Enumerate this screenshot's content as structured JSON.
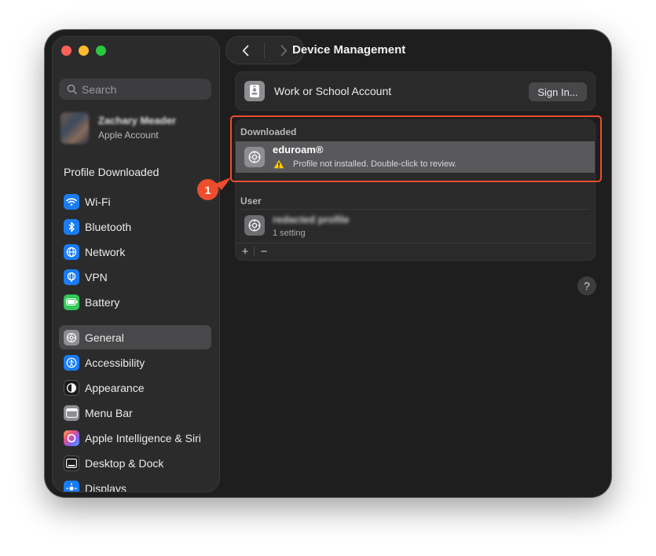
{
  "window": {
    "title": "Device Management"
  },
  "sidebar": {
    "search_placeholder": "Search",
    "account": {
      "name": "Zachary Meader",
      "subtitle": "Apple Account"
    },
    "notice": "Profile Downloaded",
    "group1": [
      {
        "label": "Wi-Fi",
        "icon": "wifi-icon",
        "color": "#1a7cf5"
      },
      {
        "label": "Bluetooth",
        "icon": "bluetooth-icon",
        "color": "#1a7cf5"
      },
      {
        "label": "Network",
        "icon": "globe-icon",
        "color": "#1a7cf5"
      },
      {
        "label": "VPN",
        "icon": "vpn-globe-icon",
        "color": "#1a7cf5"
      },
      {
        "label": "Battery",
        "icon": "battery-icon",
        "color": "#34c759"
      }
    ],
    "group2": [
      {
        "label": "General",
        "icon": "gear-icon",
        "color": "#8e8e92",
        "selected": true
      },
      {
        "label": "Accessibility",
        "icon": "accessibility-icon",
        "color": "#1a7cf5"
      },
      {
        "label": "Appearance",
        "icon": "appearance-icon",
        "color": "#1c1c1e"
      },
      {
        "label": "Menu Bar",
        "icon": "menubar-icon",
        "color": "#8e8e92"
      },
      {
        "label": "Apple Intelligence & Siri",
        "icon": "siri-icon",
        "color": "#c86bd6"
      },
      {
        "label": "Desktop & Dock",
        "icon": "dock-icon",
        "color": "#1c1c1e"
      },
      {
        "label": "Displays",
        "icon": "displays-icon",
        "color": "#1a7cf5"
      }
    ]
  },
  "main": {
    "work_account": {
      "label": "Work or School Account",
      "button": "Sign In..."
    },
    "downloaded": {
      "header": "Downloaded",
      "profile_name": "eduroam®",
      "warning": "Profile not installed. Double-click to review."
    },
    "user": {
      "header": "User",
      "profile_name": "redacted profile",
      "detail": "1 setting"
    },
    "add_label": "+",
    "remove_label": "−",
    "help_label": "?"
  },
  "annotation": {
    "callout_number": "1",
    "color": "#ee4d2d"
  }
}
